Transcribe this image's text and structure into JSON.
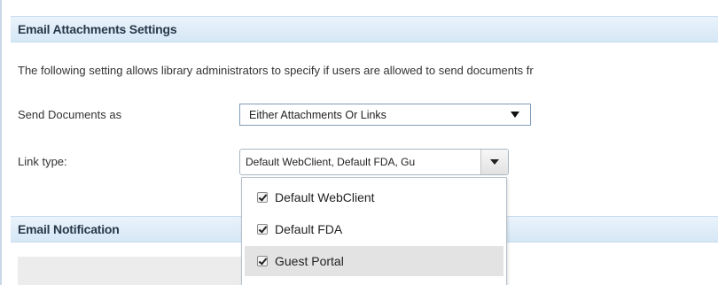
{
  "sections": {
    "attachments_title": "Email Attachments Settings",
    "notification_title": "Email Notification"
  },
  "description": "The following setting allows library administrators to specify if users are allowed to send documents fr",
  "send_documents": {
    "label": "Send Documents as",
    "value": "Either Attachments Or Links"
  },
  "link_type": {
    "label": "Link type:",
    "value": "Default WebClient, Default FDA, Gu",
    "options": [
      {
        "label": "Default WebClient",
        "checked": true
      },
      {
        "label": "Default FDA",
        "checked": true
      },
      {
        "label": "Guest Portal",
        "checked": true,
        "highlighted": true
      }
    ]
  },
  "icons": [
    "check-icon",
    "chevron-down-icon"
  ]
}
